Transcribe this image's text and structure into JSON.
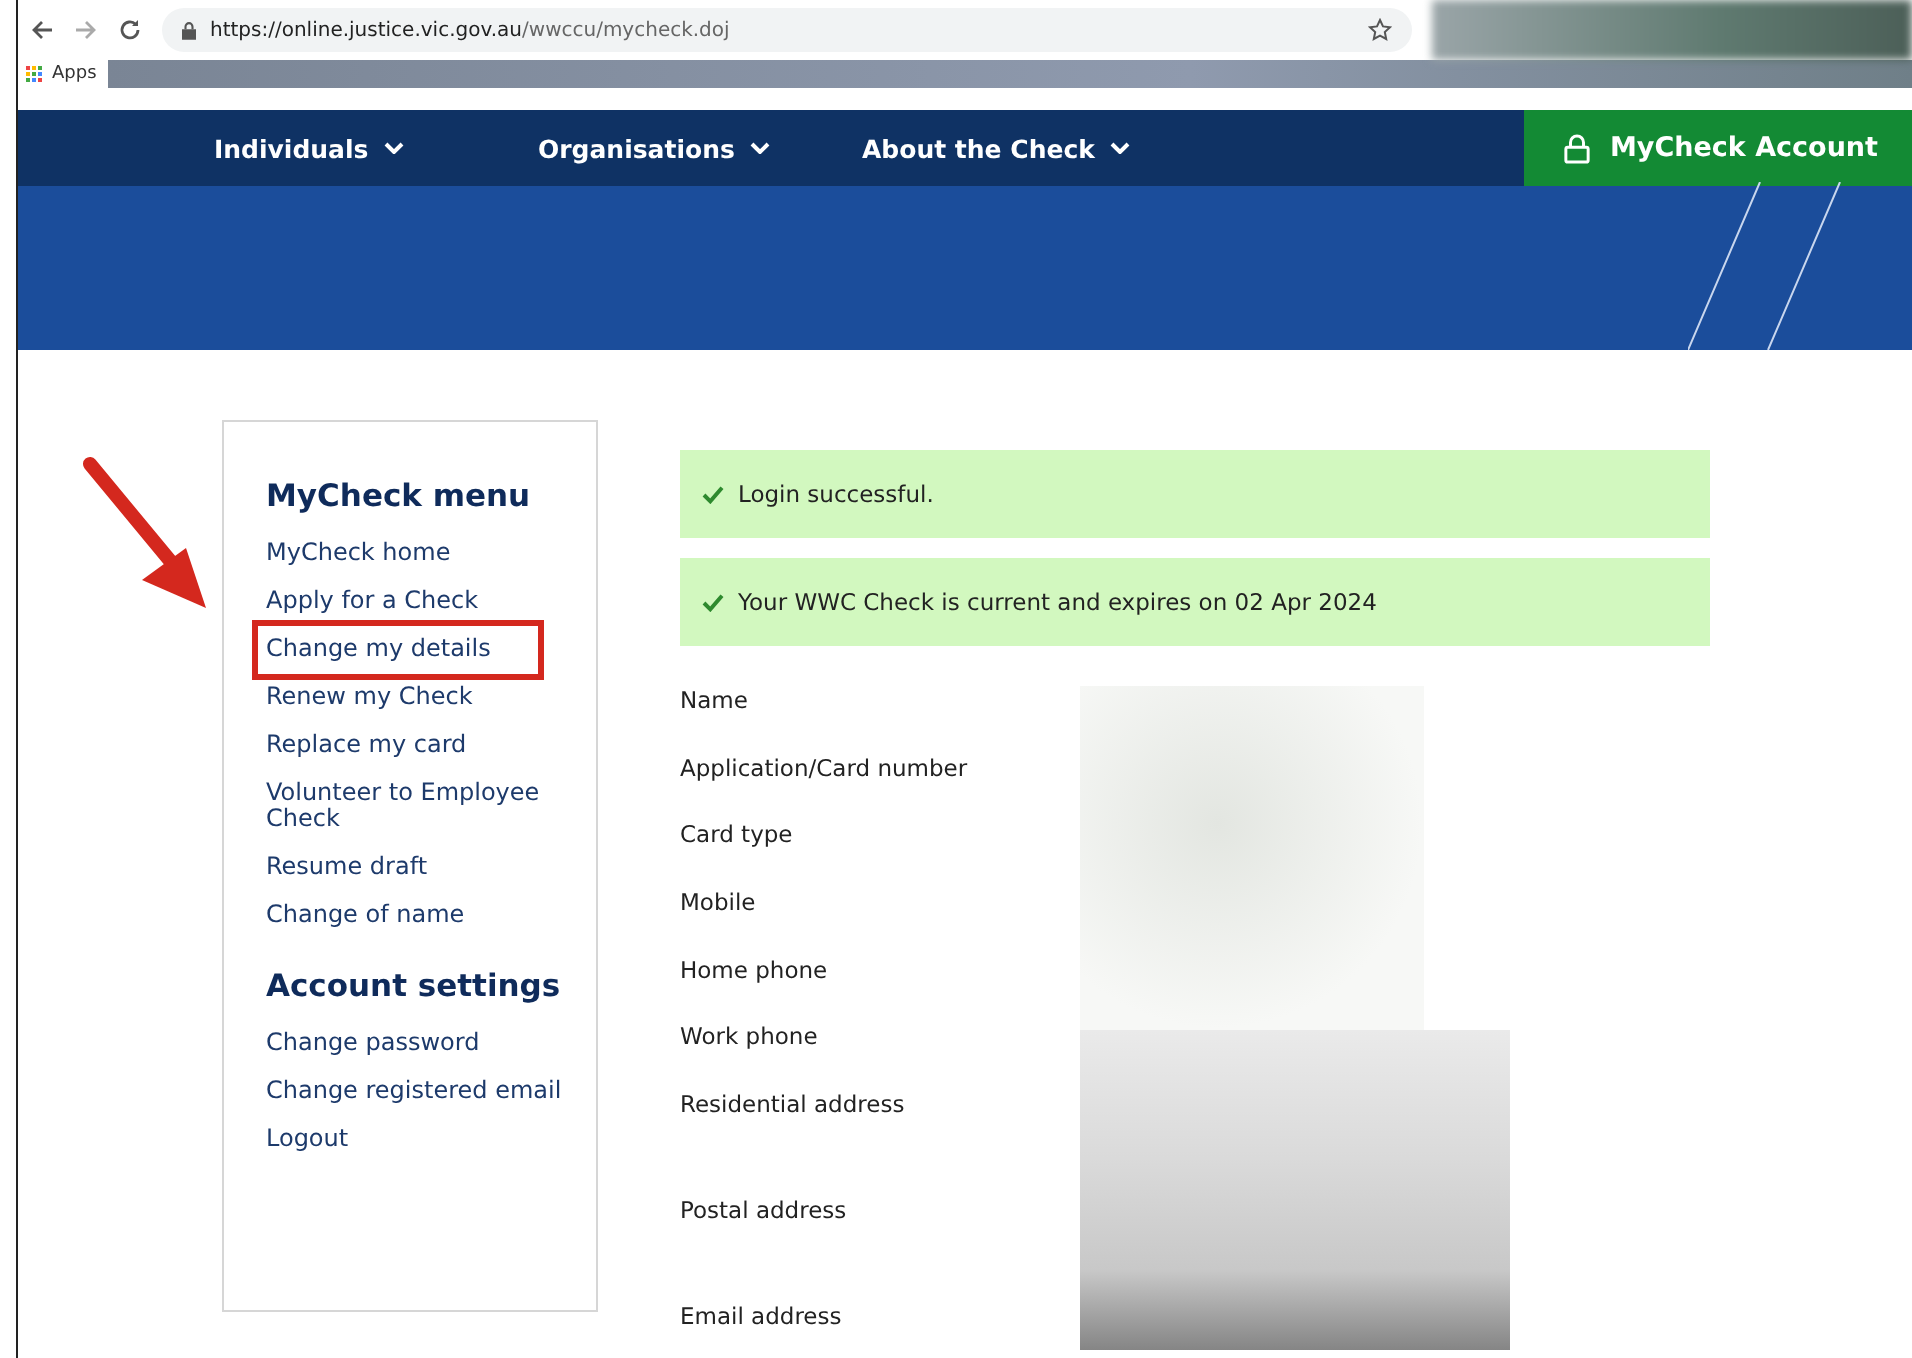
{
  "browser": {
    "url_host": "https://online.justice.vic.gov.au",
    "url_path": "/wwccu/mycheck.doj",
    "bookmarks": [
      "Apps"
    ]
  },
  "nav": {
    "items": [
      {
        "label": "Individuals"
      },
      {
        "label": "Organisations"
      },
      {
        "label": "About the Check"
      }
    ],
    "account_button": "MyCheck Account"
  },
  "sidebar": {
    "sections": [
      {
        "title": "MyCheck menu",
        "items": [
          {
            "label": "MyCheck home",
            "highlighted": false
          },
          {
            "label": "Apply for a Check",
            "highlighted": false
          },
          {
            "label": "Change my details",
            "highlighted": true
          },
          {
            "label": "Renew my Check",
            "highlighted": false
          },
          {
            "label": "Replace my card",
            "highlighted": false
          },
          {
            "label": "Volunteer to Employee Check",
            "highlighted": false
          },
          {
            "label": "Resume draft",
            "highlighted": false
          },
          {
            "label": "Change of name",
            "highlighted": false
          }
        ]
      },
      {
        "title": "Account settings",
        "items": [
          {
            "label": "Change password",
            "highlighted": false
          },
          {
            "label": "Change registered email",
            "highlighted": false
          },
          {
            "label": "Logout",
            "highlighted": false
          }
        ]
      }
    ]
  },
  "alerts": [
    {
      "text": "Login successful."
    },
    {
      "text": "Your WWC Check is current and expires on 02 Apr 2024"
    }
  ],
  "fields": [
    {
      "label": "Name",
      "kind": "short"
    },
    {
      "label": "Application/Card number",
      "kind": "short"
    },
    {
      "label": "Card type",
      "kind": "short"
    },
    {
      "label": "Mobile",
      "kind": "short"
    },
    {
      "label": "Home phone",
      "kind": "short"
    },
    {
      "label": "Work phone",
      "kind": "short"
    },
    {
      "label": "Residential address",
      "kind": "tall"
    },
    {
      "label": "Postal address",
      "kind": "tall"
    },
    {
      "label": "Email address",
      "kind": "short"
    }
  ]
}
